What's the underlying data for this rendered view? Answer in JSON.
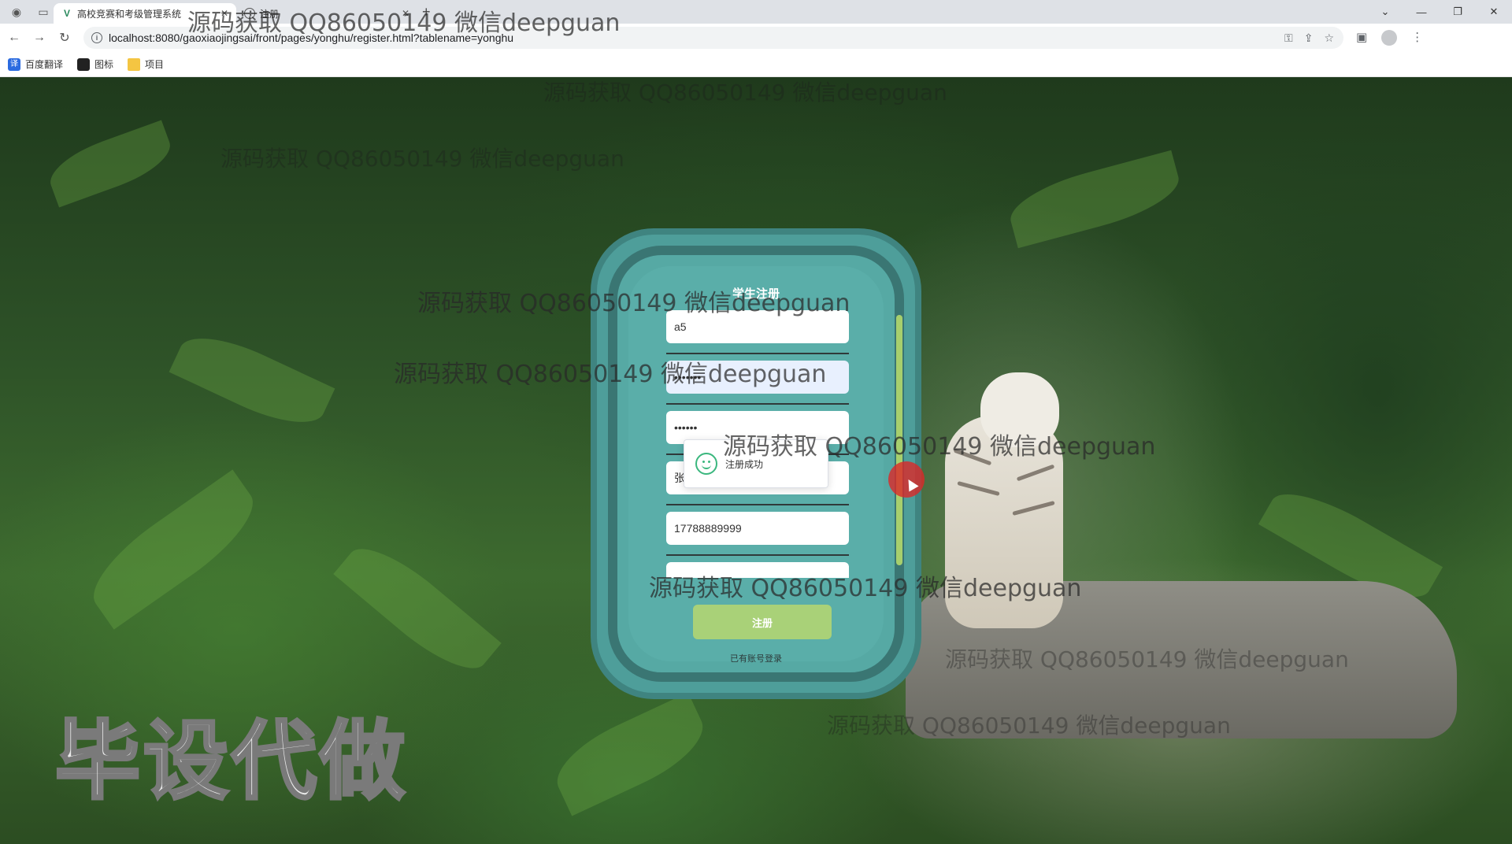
{
  "browser": {
    "tabs": [
      {
        "title": "高校竞赛和考级管理系统",
        "active": true,
        "icon": "vue-icon"
      },
      {
        "title": "注册",
        "active": false,
        "icon": "globe-icon"
      }
    ],
    "url": "localhost:8080/gaoxiaojingsai/front/pages/yonghu/register.html?tablename=yonghu",
    "bookmarks": [
      {
        "label": "百度翻译",
        "icon": "translate-icon"
      },
      {
        "label": "图标",
        "icon": "image-icon"
      },
      {
        "label": "项目",
        "icon": "folder-icon"
      }
    ]
  },
  "form": {
    "title": "学生注册",
    "fields": [
      {
        "name": "account",
        "value": "a5",
        "type": "text"
      },
      {
        "name": "password",
        "value": "•••••••",
        "type": "password"
      },
      {
        "name": "confirm-password",
        "value": "••••••",
        "type": "password"
      },
      {
        "name": "real-name",
        "value": "张5",
        "type": "text"
      },
      {
        "name": "phone",
        "value": "17788889999",
        "type": "text"
      },
      {
        "name": "extra",
        "value": "",
        "type": "text"
      }
    ],
    "submit_label": "注册",
    "login_link": "已有账号登录"
  },
  "toast": {
    "message": "注册成功",
    "icon": "smile-icon"
  },
  "watermarks": {
    "text": "源码获取 QQ86050149 微信deepguan",
    "big": "毕设代做"
  },
  "colors": {
    "card": "#56a9a4",
    "card_border": "#3a7673",
    "button": "#a9d178",
    "scrollbar": "#a7cf6d"
  }
}
